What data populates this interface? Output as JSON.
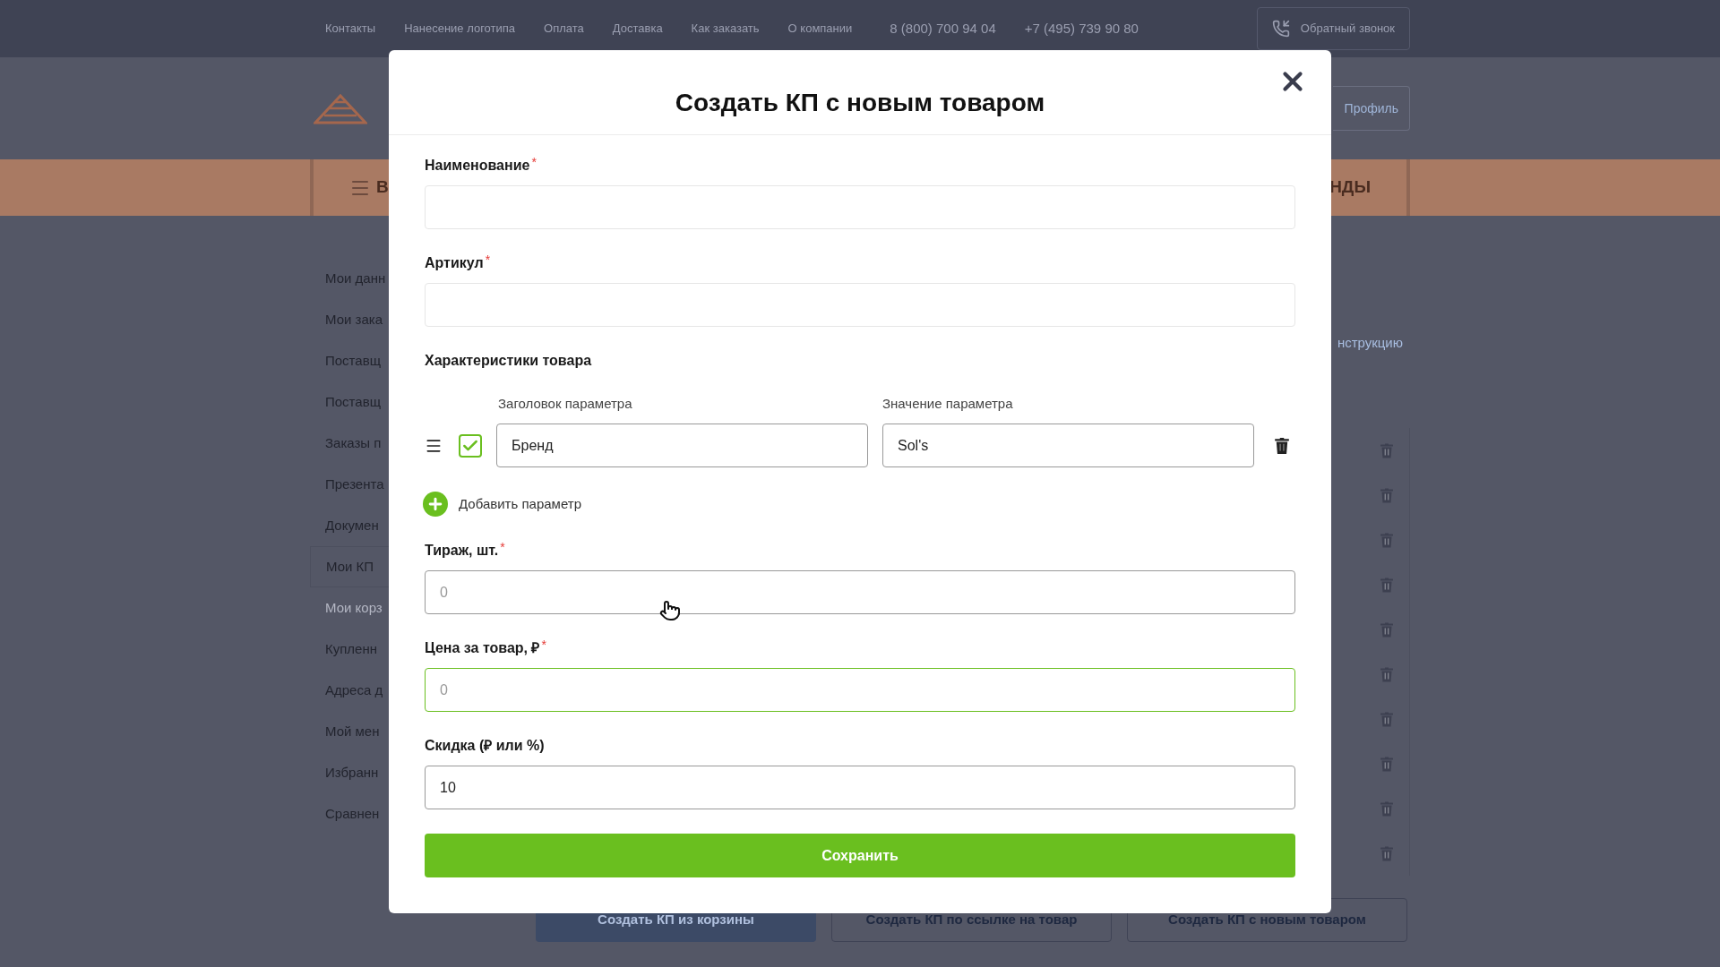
{
  "top_bar": {
    "links": [
      "Контакты",
      "Нанесение логотипа",
      "Оплата",
      "Доставка",
      "Как заказать",
      "О компании"
    ],
    "phones": [
      "8 (800) 700 94 04",
      "+7 (495) 739 90 80"
    ],
    "callback_button": "Обратный звонок"
  },
  "header": {
    "profile_button": "Профиль"
  },
  "nav_bar": {
    "left_label": "В",
    "right_label": "НДЫ"
  },
  "sidebar": {
    "items": [
      {
        "label": "Мои данн",
        "selected": false,
        "disabled": false
      },
      {
        "label": "Мои зака",
        "selected": false,
        "disabled": false
      },
      {
        "label": "Поставщ",
        "selected": false,
        "disabled": false
      },
      {
        "label": "Поставщ",
        "selected": false,
        "disabled": false
      },
      {
        "label": "Заказы п",
        "selected": false,
        "disabled": false
      },
      {
        "label": "Презента",
        "selected": false,
        "disabled": false
      },
      {
        "label": "Докумен",
        "selected": false,
        "disabled": false
      },
      {
        "label": "Мои КП",
        "selected": true,
        "disabled": false
      },
      {
        "label": "Мои корз",
        "selected": false,
        "disabled": true
      },
      {
        "label": "Купленн",
        "selected": false,
        "disabled": false
      },
      {
        "label": "Адреса д",
        "selected": false,
        "disabled": false
      },
      {
        "label": "Мой мен",
        "selected": false,
        "disabled": false
      },
      {
        "label": "Избранн",
        "selected": false,
        "disabled": false
      },
      {
        "label": "Сравнен",
        "selected": false,
        "disabled": false
      }
    ]
  },
  "instruction_link": "нструкцию",
  "bottom_buttons": [
    {
      "label": "Создать КП из корзины",
      "selected": true
    },
    {
      "label": "Создать КП по ссылке на товар",
      "selected": false
    },
    {
      "label": "Создать КП с новым товаром",
      "selected": false
    }
  ],
  "modal": {
    "title": "Создать КП с новым товаром",
    "sections": [
      {
        "kind": "light-field",
        "label": "Наименование",
        "required_mark": "*",
        "focused": false
      },
      {
        "kind": "light-field",
        "label": "Артикул",
        "required_mark": "*",
        "focused": false
      },
      {
        "kind": "params",
        "label": "Характеристики товара",
        "title_label": "Заголовок параметра",
        "value_label": "Значение параметра",
        "rows": [
          {
            "checked": true,
            "title": "Бренд",
            "value": "Sol's"
          }
        ],
        "add_label": "Добавить параметр"
      },
      {
        "kind": "field",
        "label": "Тираж, шт.",
        "required_mark": "*",
        "placeholder": "0",
        "focused": false
      },
      {
        "kind": "field",
        "label": "Цена за товар, ₽",
        "required_mark": "*",
        "placeholder": "0",
        "focused": true
      },
      {
        "kind": "field",
        "label": "Скидка (₽ или %)",
        "value": "10",
        "focused": false
      }
    ],
    "save_button": "Сохранить"
  }
}
